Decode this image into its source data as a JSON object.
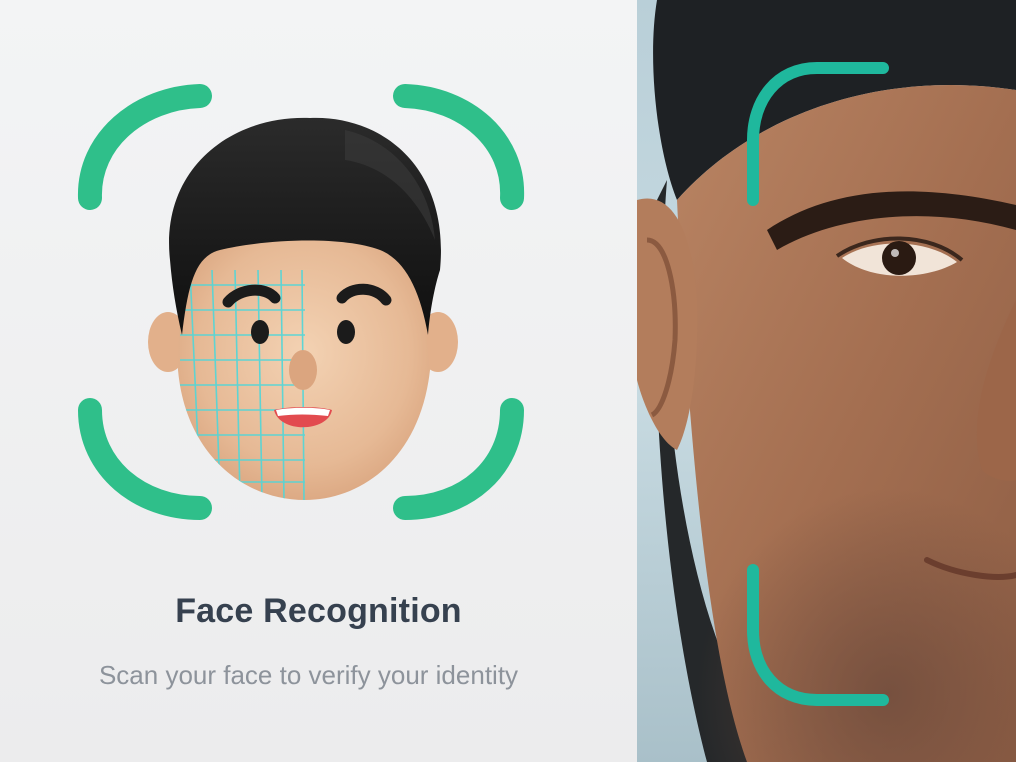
{
  "card": {
    "title": "Face Recognition",
    "subtitle": "Scan your face to verify your identity"
  },
  "icons": {
    "avatar": "3d-avatar-face-icon",
    "scan_frame": "scan-corner-brackets-icon",
    "face_mesh": "face-mesh-grid-icon"
  },
  "colors": {
    "accent_green": "#2fbf8a",
    "scan_teal": "#1fb89d",
    "title": "#36414f",
    "subtitle": "#8d939b"
  }
}
